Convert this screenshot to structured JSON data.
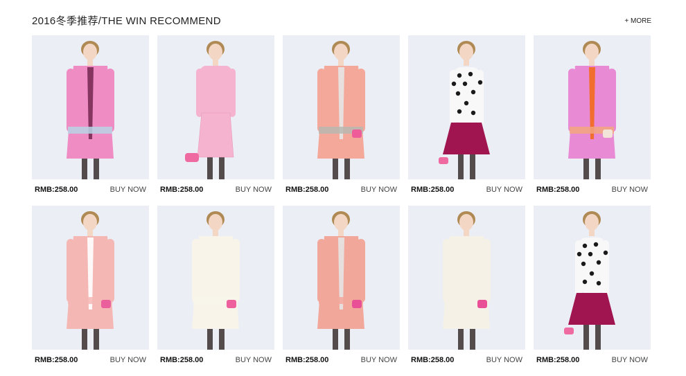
{
  "header": {
    "title": "2016冬季推荐/THE WIN RECOMMEND",
    "more_label": "+ MORE"
  },
  "products": [
    {
      "price": "RMB:258.00",
      "buy_label": "BUY NOW",
      "garment": "coat",
      "color": "#f08cc4",
      "accent": "#b9d3e6",
      "skirt": "#7a2a55",
      "bag": ""
    },
    {
      "price": "RMB:258.00",
      "buy_label": "BUY NOW",
      "garment": "suit",
      "color": "#f5b3cf",
      "accent": "#f5b3cf",
      "skirt": "#f5b3cf",
      "bag": "#ee6aa0"
    },
    {
      "price": "RMB:258.00",
      "buy_label": "BUY NOW",
      "garment": "coat",
      "color": "#f4a89a",
      "accent": "#b7b7b0",
      "skirt": "#e6e6e6",
      "bag": "#ef5c9a"
    },
    {
      "price": "RMB:258.00",
      "buy_label": "BUY NOW",
      "garment": "sweater",
      "color": "#f8f8f8",
      "accent": "#1a1a1a",
      "skirt": "#a0144f",
      "bag": "#ee6aa0"
    },
    {
      "price": "RMB:258.00",
      "buy_label": "BUY NOW",
      "garment": "coat",
      "color": "#e98ad4",
      "accent": "#f3a47d",
      "skirt": "#f36a1c",
      "bag": "#f2e4d8"
    },
    {
      "price": "RMB:258.00",
      "buy_label": "BUY NOW",
      "garment": "coat",
      "color": "#f4b7b4",
      "accent": "#f4b7b4",
      "skirt": "#ffffff",
      "bag": "#e9609c"
    },
    {
      "price": "RMB:258.00",
      "buy_label": "BUY NOW",
      "garment": "coat",
      "color": "#f8f4ea",
      "accent": "#f8f4ea",
      "skirt": "#f8f4ea",
      "bag": "#ee5f9e"
    },
    {
      "price": "RMB:258.00",
      "buy_label": "BUY NOW",
      "garment": "coat",
      "color": "#f2a79b",
      "accent": "#f2a79b",
      "skirt": "#e6e6e6",
      "bag": "#e94f97"
    },
    {
      "price": "RMB:258.00",
      "buy_label": "BUY NOW",
      "garment": "coat",
      "color": "#f5f1e6",
      "accent": "#f5f1e6",
      "skirt": "#f5f1e6",
      "bag": "#e94f97"
    },
    {
      "price": "RMB:258.00",
      "buy_label": "BUY NOW",
      "garment": "sweater",
      "color": "#f8f8f8",
      "accent": "#1a1a1a",
      "skirt": "#a0144f",
      "bag": "#ee6aa0"
    }
  ]
}
